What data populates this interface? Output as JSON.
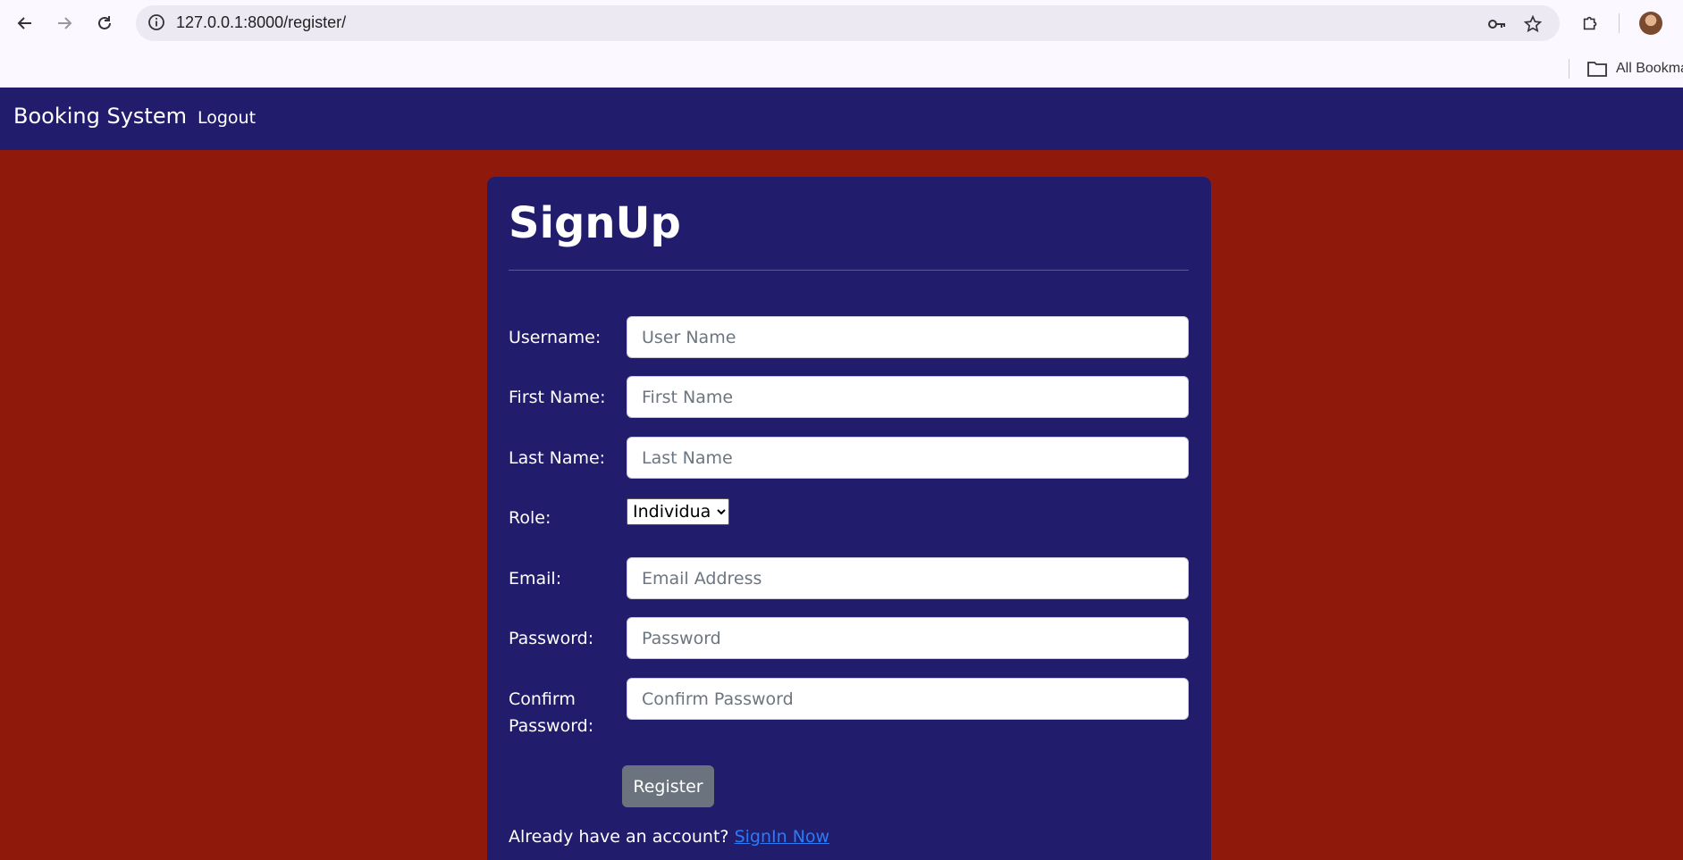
{
  "browser": {
    "url": "127.0.0.1:8000/register/",
    "bookmarks_folder": "All Bookmarks"
  },
  "navbar": {
    "brand": "Booking System",
    "logout_label": "Logout"
  },
  "signup": {
    "title": "SignUp",
    "fields": {
      "username": {
        "label": "Username:",
        "placeholder": "User Name"
      },
      "first_name": {
        "label": "First Name:",
        "placeholder": "First Name"
      },
      "last_name": {
        "label": "Last Name:",
        "placeholder": "Last Name"
      },
      "role": {
        "label": "Role:",
        "selected": "Individual"
      },
      "email": {
        "label": "Email:",
        "placeholder": "Email Address"
      },
      "password": {
        "label": "Password:",
        "placeholder": "Password"
      },
      "confirm_password": {
        "label_line1": "Confirm",
        "label_line2": "Password:",
        "placeholder": "Confirm Password"
      }
    },
    "register_label": "Register",
    "already_text": "Already have an account?",
    "signin_link": "SignIn Now"
  },
  "colors": {
    "page_background": "#8f1a0b",
    "navbar_background": "#211c6b",
    "card_background": "#211c6b",
    "register_button": "#6b747e",
    "link": "#2b7bf7"
  }
}
